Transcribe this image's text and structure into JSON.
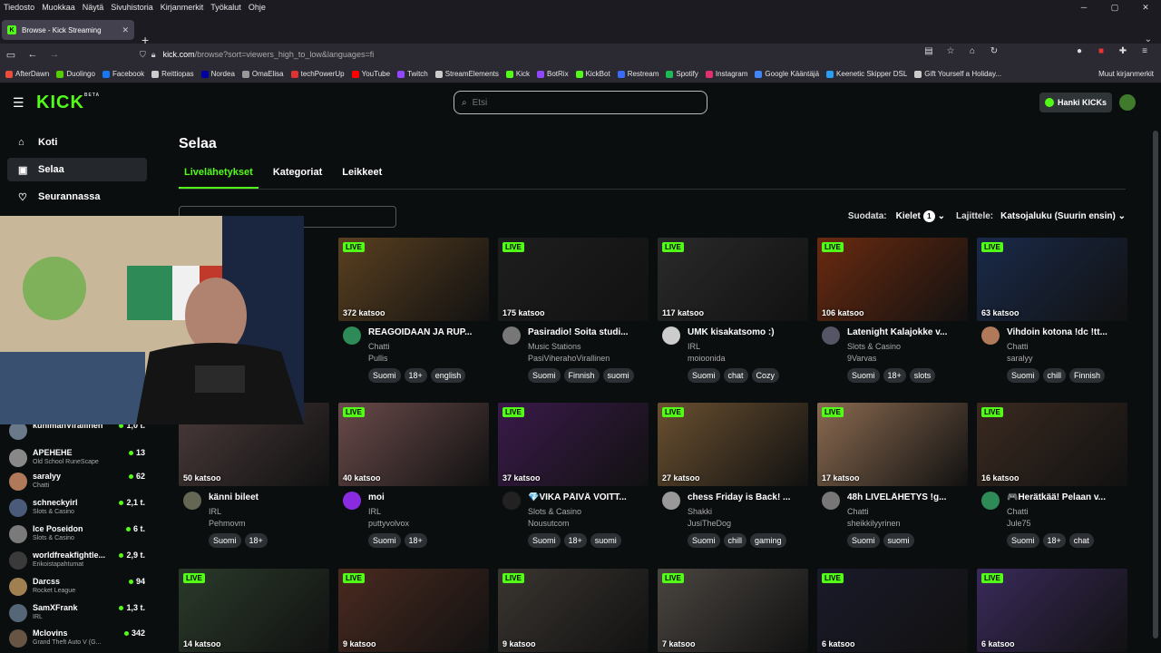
{
  "browser": {
    "menu": [
      "Tiedosto",
      "Muokkaa",
      "Näytä",
      "Sivuhistoria",
      "Kirjanmerkit",
      "Työkalut",
      "Ohje"
    ],
    "tab_title": "Browse - Kick Streaming",
    "url_host": "kick.com",
    "url_rest": "/browse?sort=viewers_high_to_low&languages=fi",
    "bookmarks": [
      {
        "label": "AfterDawn",
        "color": "#e84d3d"
      },
      {
        "label": "Duolingo",
        "color": "#58cc02"
      },
      {
        "label": "Facebook",
        "color": "#1877f2"
      },
      {
        "label": "Reittiopas",
        "color": "#cccccc"
      },
      {
        "label": "Nordea",
        "color": "#0000a0"
      },
      {
        "label": "OmaElisa",
        "color": "#999999"
      },
      {
        "label": "techPowerUp",
        "color": "#d33"
      },
      {
        "label": "YouTube",
        "color": "#ff0000"
      },
      {
        "label": "Twitch",
        "color": "#9146ff"
      },
      {
        "label": "StreamElements",
        "color": "#cccccc"
      },
      {
        "label": "Kick",
        "color": "#53fc18"
      },
      {
        "label": "BotRix",
        "color": "#9146ff"
      },
      {
        "label": "KickBot",
        "color": "#53fc18"
      },
      {
        "label": "Restream",
        "color": "#3a6bff"
      },
      {
        "label": "Spotify",
        "color": "#1db954"
      },
      {
        "label": "Instagram",
        "color": "#e1306c"
      },
      {
        "label": "Google Kääntäjä",
        "color": "#4285f4"
      },
      {
        "label": "Keenetic Skipper DSL",
        "color": "#2a9df4"
      },
      {
        "label": "Gift Yourself a Holiday...",
        "color": "#cccccc"
      }
    ],
    "other_bookmarks": "Muut kirjanmerkit"
  },
  "header": {
    "logo": "KICK",
    "logo_beta": "BETA",
    "search_placeholder": "Etsi",
    "kicks_button": "Hanki KICKs"
  },
  "sidebar": {
    "nav": [
      {
        "label": "Koti",
        "icon": "home-icon"
      },
      {
        "label": "Selaa",
        "icon": "browse-icon"
      },
      {
        "label": "Seurannassa",
        "icon": "heart-icon"
      }
    ],
    "channels": [
      {
        "name": "kunimanVirallinen",
        "category": "",
        "viewers": "1,0 t.",
        "color": "#6b7a8a"
      },
      {
        "name": "APEHEHE",
        "category": "Old School RuneScape",
        "viewers": "13",
        "color": "#888"
      },
      {
        "name": "saralyy",
        "category": "Chatti",
        "viewers": "62",
        "color": "#b07a5a"
      },
      {
        "name": "schneckyirl",
        "category": "Slots & Casino",
        "viewers": "2,1 t.",
        "color": "#4a5a7a"
      },
      {
        "name": "Ice Poseidon",
        "category": "Slots & Casino",
        "viewers": "6 t.",
        "color": "#7a7a7a"
      },
      {
        "name": "worldfreakfightle...",
        "category": "Erikoistapahtumat",
        "viewers": "2,9 t.",
        "color": "#3a3a3a"
      },
      {
        "name": "Darcss",
        "category": "Rocket League",
        "viewers": "94",
        "color": "#a08050"
      },
      {
        "name": "SamXFrank",
        "category": "IRL",
        "viewers": "1,3 t.",
        "color": "#556677"
      },
      {
        "name": "Mclovins",
        "category": "Grand Theft Auto V (G...",
        "viewers": "342",
        "color": "#665544"
      }
    ]
  },
  "main": {
    "title": "Selaa",
    "tabs": [
      "Livelähetykset",
      "Kategoriat",
      "Leikkeet"
    ],
    "filter_label": "Suodata:",
    "languages_label": "Kielet",
    "languages_count": "1",
    "sort_label": "Lajittele:",
    "sort_value": "Katsojaluku (Suurin ensin)",
    "live_label": "LIVE",
    "cards": [
      {
        "title": "REAGOIDAAN JA RUP...",
        "category": "Chatti",
        "channel": "Pullis",
        "viewers": "372 katsoo",
        "tags": [
          "Suomi",
          "18+",
          "english"
        ],
        "color": "#5a4020",
        "ava": "#2e8b57"
      },
      {
        "title": "Pasiradio! Soita studi...",
        "category": "Music Stations",
        "channel": "PasiViherahoVirallinen",
        "viewers": "175 katsoo",
        "tags": [
          "Suomi",
          "Finnish",
          "suomi"
        ],
        "color": "#1e1e1e",
        "ava": "#777"
      },
      {
        "title": "UMK kisakatsomo :)",
        "category": "IRL",
        "channel": "moioonida",
        "viewers": "117 katsoo",
        "tags": [
          "Suomi",
          "chat",
          "Cozy"
        ],
        "color": "#2a2a2a",
        "ava": "#ccc"
      },
      {
        "title": "Latenight Kalajokke v...",
        "category": "Slots & Casino",
        "channel": "9Varvas",
        "viewers": "106 katsoo",
        "tags": [
          "Suomi",
          "18+",
          "slots"
        ],
        "color": "#6a2a10",
        "ava": "#556"
      },
      {
        "title": "Vihdoin kotona !dc !tt...",
        "category": "Chatti",
        "channel": "saralyy",
        "viewers": "63 katsoo",
        "tags": [
          "Suomi",
          "chill",
          "Finnish"
        ],
        "color": "#1a2a4a",
        "ava": "#b07a5a"
      },
      {
        "title": "känni bileet",
        "category": "IRL",
        "channel": "Pehmovm",
        "viewers": "50 katsoo",
        "tags": [
          "Suomi",
          "18+"
        ],
        "color": "#4a3a3a",
        "ava": "#665"
      },
      {
        "title": "moi",
        "category": "IRL",
        "channel": "puttyvolvox",
        "viewers": "40 katsoo",
        "tags": [
          "Suomi",
          "18+"
        ],
        "color": "#6a4a4a",
        "ava": "#8a2be2"
      },
      {
        "title": "💎VIKA PÄIVÄ VOITT...",
        "category": "Slots & Casino",
        "channel": "Nousutcom",
        "viewers": "37 katsoo",
        "tags": [
          "Suomi",
          "18+",
          "suomi"
        ],
        "color": "#3a1a4a",
        "ava": "#222"
      },
      {
        "title": "chess Friday is Back! ...",
        "category": "Shakki",
        "channel": "JusiTheDog",
        "viewers": "27 katsoo",
        "tags": [
          "Suomi",
          "chill",
          "gaming"
        ],
        "color": "#6a5030",
        "ava": "#999"
      },
      {
        "title": "48h LIVELÄHETYS !g...",
        "category": "Chatti",
        "channel": "sheikkilyyrinen",
        "viewers": "17 katsoo",
        "tags": [
          "Suomi",
          "suomi"
        ],
        "color": "#8a6a50",
        "ava": "#777"
      },
      {
        "title": "🎮Herätkää! Pelaan v...",
        "category": "Chatti",
        "channel": "Jule75",
        "viewers": "16 katsoo",
        "tags": [
          "Suomi",
          "18+",
          "chat"
        ],
        "color": "#3a2a20",
        "ava": "#2e8b57"
      },
      {
        "title": "",
        "category": "",
        "channel": "",
        "viewers": "14 katsoo",
        "tags": [],
        "color": "#2a3a2a",
        "ava": ""
      },
      {
        "title": "",
        "category": "",
        "channel": "",
        "viewers": "9 katsoo",
        "tags": [],
        "color": "#4a2a20",
        "ava": ""
      },
      {
        "title": "",
        "category": "",
        "channel": "",
        "viewers": "9 katsoo",
        "tags": [],
        "color": "#3a3530",
        "ava": ""
      },
      {
        "title": "",
        "category": "",
        "channel": "",
        "viewers": "7 katsoo",
        "tags": [],
        "color": "#4a4540",
        "ava": ""
      },
      {
        "title": "",
        "category": "",
        "channel": "",
        "viewers": "6 katsoo",
        "tags": [],
        "color": "#1a1a2a",
        "ava": ""
      },
      {
        "title": "",
        "category": "",
        "channel": "",
        "viewers": "6 katsoo",
        "tags": [],
        "color": "#3a2a5a",
        "ava": ""
      }
    ]
  }
}
